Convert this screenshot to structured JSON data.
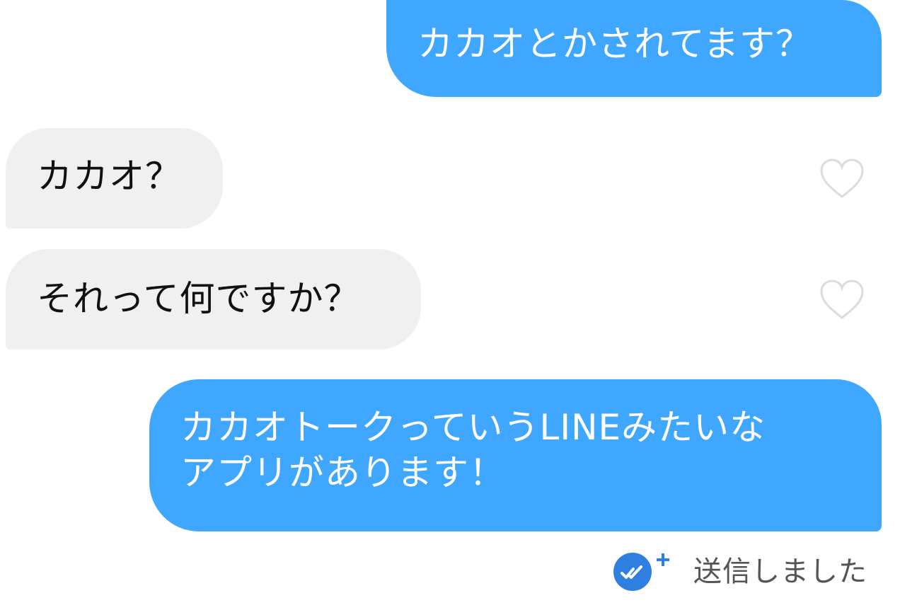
{
  "messages": [
    {
      "direction": "sent",
      "text": "カカオとかされてます？"
    },
    {
      "direction": "received",
      "text": "カカオ？"
    },
    {
      "direction": "received",
      "text": "それって何ですか？"
    },
    {
      "direction": "sent",
      "text": "カカオトークっていうLINEみたいな\nアプリがあります！"
    }
  ],
  "status": {
    "text": "送信しました",
    "icon": "read-check-icon"
  },
  "colors": {
    "sent_bubble": "#3fa7ff",
    "received_bubble": "#f0f0f0",
    "status_icon": "#2f7fe0"
  },
  "icons": {
    "like": "heart-outline-icon",
    "plus": "plus-icon"
  }
}
